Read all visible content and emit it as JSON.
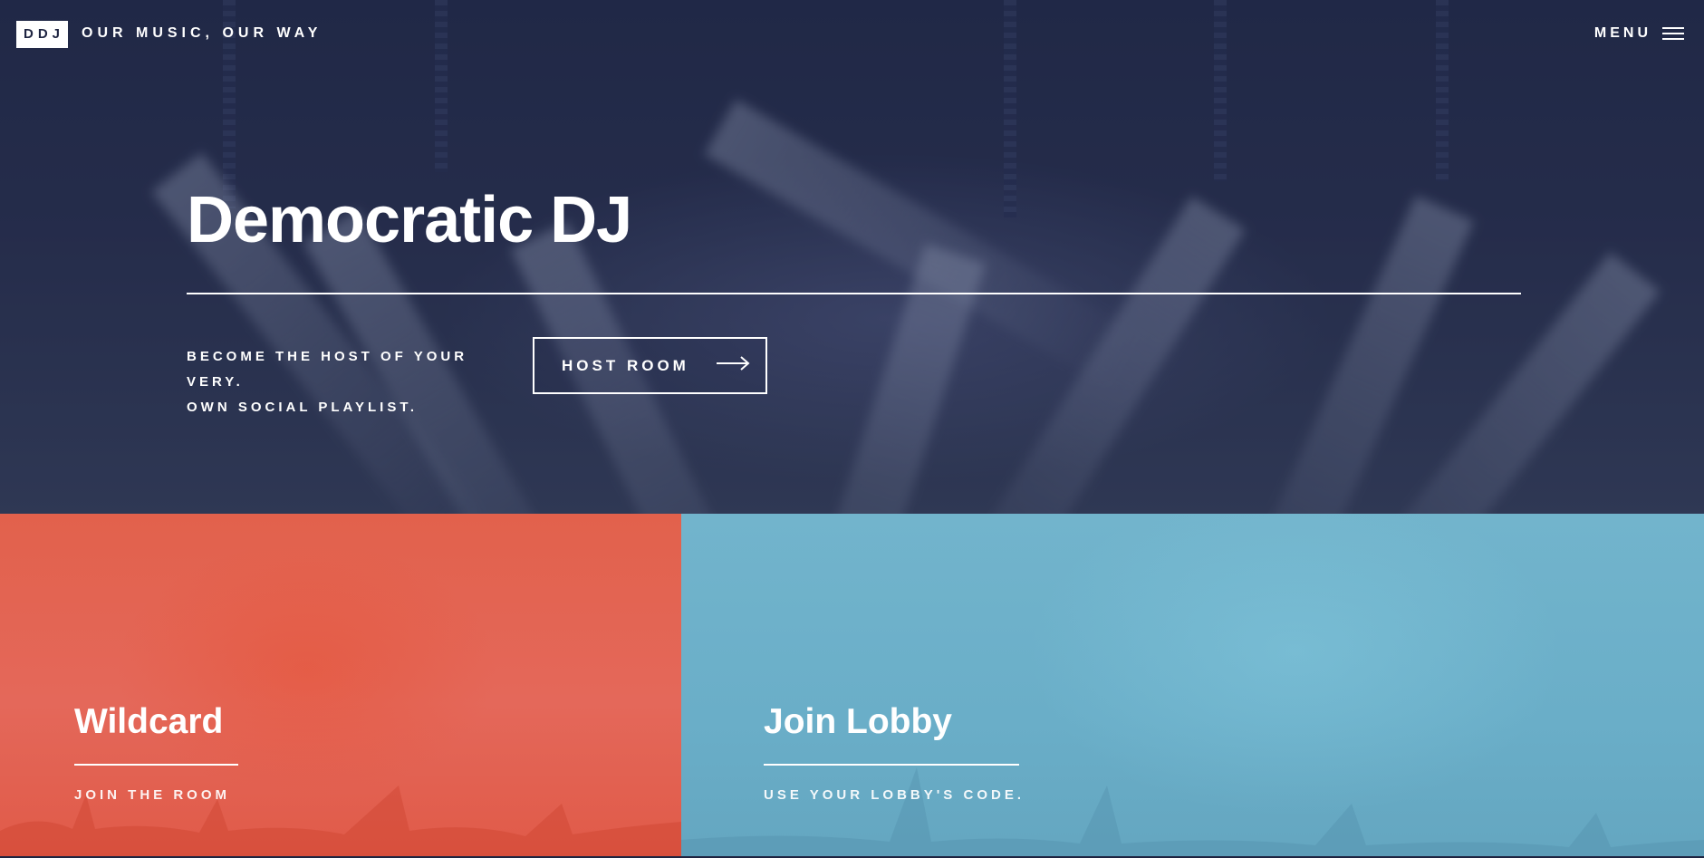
{
  "header": {
    "logo_text": "DDJ",
    "tagline": "OUR MUSIC, OUR WAY",
    "menu_label": "MENU",
    "menu_icon": "hamburger-icon"
  },
  "hero": {
    "title": "Democratic DJ",
    "subtitle_line1": "BECOME THE HOST OF YOUR VERY.",
    "subtitle_line2": "OWN SOCIAL PLAYLIST.",
    "button_label": "HOST ROOM",
    "button_icon": "arrow-right-icon"
  },
  "panels": [
    {
      "title": "Wildcard",
      "subtitle": "JOIN THE ROOM",
      "color": "#e2614c"
    },
    {
      "title": "Join Lobby",
      "subtitle": "USE YOUR LOBBY'S CODE.",
      "color": "#6aaec8"
    }
  ],
  "colors": {
    "hero_background": "#232a4a",
    "text": "#ffffff",
    "logo_text": "#1f2542"
  }
}
